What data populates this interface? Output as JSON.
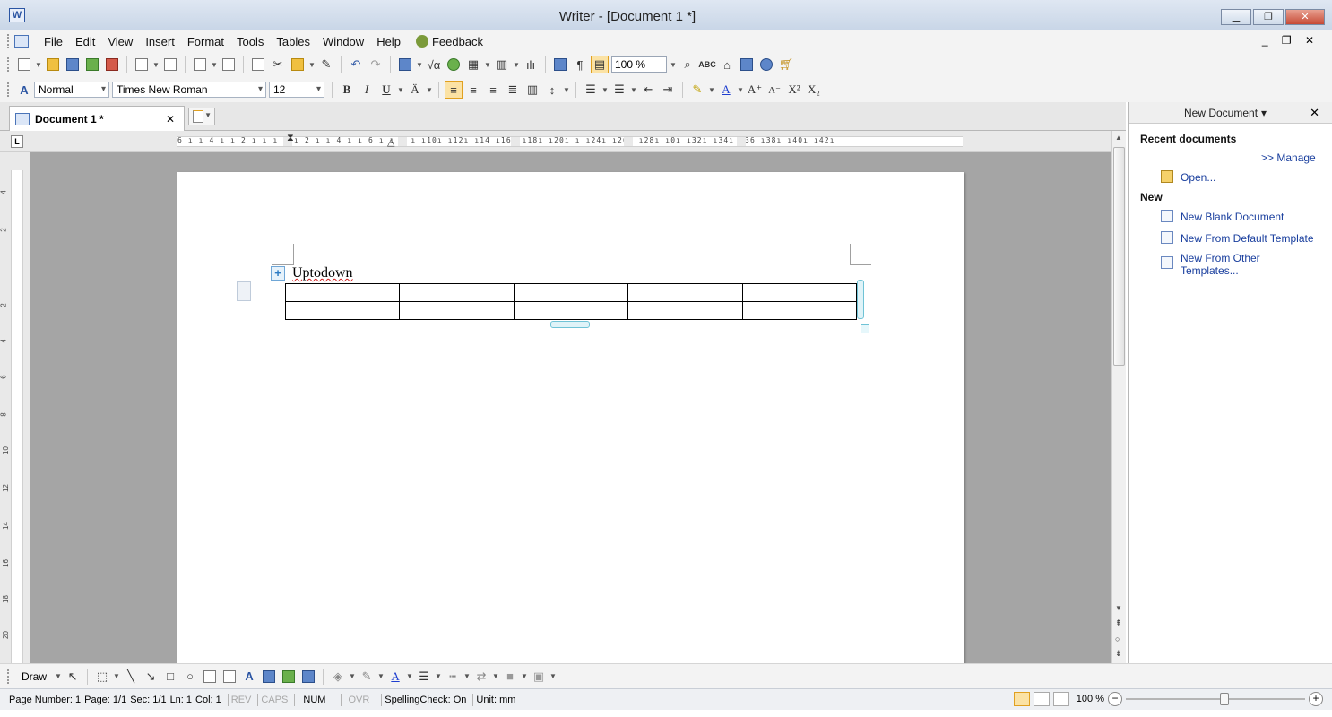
{
  "window": {
    "title": "Writer - [Document 1 *]",
    "minimize": "▁",
    "maximize": "❐",
    "close": "✕"
  },
  "menu": {
    "items": [
      "File",
      "Edit",
      "View",
      "Insert",
      "Format",
      "Tools",
      "Tables",
      "Window",
      "Help"
    ],
    "feedback": "Feedback",
    "mdi_controls": "_ ❐ ✕"
  },
  "standard_toolbar": {
    "zoom": "100 %"
  },
  "format_toolbar": {
    "style": "Normal",
    "font": "Times New Roman",
    "size": "12",
    "bold": "B",
    "italic": "I",
    "underline": "U"
  },
  "tabs": {
    "document_tab": "Document 1 *",
    "close": "✕"
  },
  "ruler": {
    "corner": "L",
    "text": "6 ı  ı 4 ı  ı 2 ı  ı  ı  ı  ı 2 ı  ı 4 ı  ı 6 ı  ı 8 ı  ı10ı  ı12ı  ı14  ı16ı  ı18ı  ı20ı   ı     ı24ı  ı26ı  ı28ı     ı0ı  ı32ı  ı34ı  ı36  ı38ı  ı40ı  ı42ı",
    "vertical_numbers": [
      "4",
      "2",
      "2",
      "4",
      "6",
      "8",
      "10",
      "12",
      "14",
      "16",
      "18",
      "20"
    ]
  },
  "document": {
    "text": "Uptodown",
    "table": {
      "rows": 2,
      "cols": 5
    }
  },
  "task_pane": {
    "title": "New Document",
    "recent_heading": "Recent documents",
    "manage": ">> Manage",
    "open": "Open...",
    "new_heading": "New",
    "new_blank": "New Blank Document",
    "new_default": "New From Default Template",
    "new_other": "New From Other Templates..."
  },
  "draw_toolbar": {
    "label": "Draw"
  },
  "status": {
    "page_number": "Page Number: 1",
    "page": "Page: 1/1",
    "sec": "Sec: 1/1",
    "ln": "Ln: 1",
    "col": "Col: 1",
    "rev": "REV",
    "caps": "CAPS",
    "num": "NUM",
    "ovr": "OVR",
    "spelling": "SpellingCheck: On",
    "unit": "Unit: mm",
    "zoom": "100 %",
    "zoom_level": 0.55
  },
  "colors": {
    "accent": "#fbe2a4",
    "link": "#1a3f9e",
    "font_color": "#1f3fd0",
    "highlight": "#f2e400"
  }
}
